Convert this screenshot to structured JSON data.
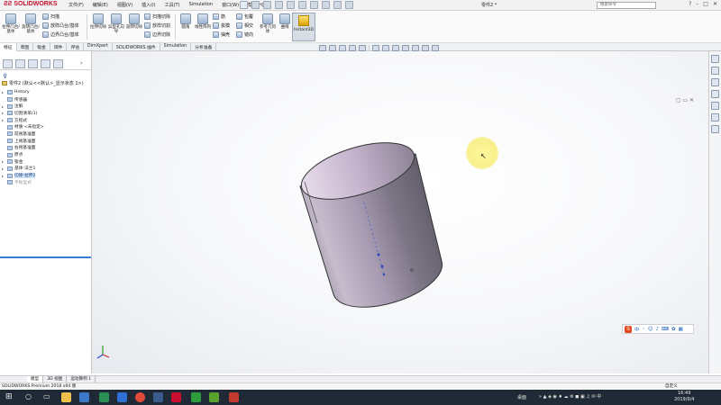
{
  "app": {
    "brand": "SOLIDWORKS",
    "menu": [
      "文件(F)",
      "编辑(E)",
      "视图(V)",
      "插入(I)",
      "工具(T)",
      "Simulation",
      "窗口(W)",
      "帮助(H)"
    ],
    "document_title": "零件2 *",
    "search_placeholder": "搜索命令"
  },
  "ribbon": {
    "big_buttons": [
      "拉伸凸台/基体",
      "旋转凸台/基体",
      "拉伸切除",
      "异型孔向导",
      "旋转切除",
      "圆角",
      "线性阵列",
      "参考几何体",
      "曲线"
    ],
    "small_buttons": [
      "扫描",
      "放样凸台/基体",
      "边界凸台/基体",
      "扫描切除",
      "放样切割",
      "边界切除",
      "筋",
      "拔模",
      "抽壳",
      "包覆",
      "相交",
      "镜向"
    ],
    "instant3d": "Instant3D"
  },
  "command_tabs": [
    "特征",
    "草图",
    "钣金",
    "焊件",
    "评估",
    "DimXpert",
    "SOLIDWORKS 插件",
    "Simulation",
    "分析准备"
  ],
  "tree": {
    "root": "零件2 (默认<<默认>_显示状态 1>)",
    "items": [
      {
        "label": "History",
        "exp": "▸",
        "state": "normal"
      },
      {
        "label": "传感器",
        "exp": "",
        "state": "normal"
      },
      {
        "label": "注解",
        "exp": "▸",
        "state": "normal"
      },
      {
        "label": "切割清单(1)",
        "exp": "▸",
        "state": "normal"
      },
      {
        "label": "方程式",
        "exp": "▸",
        "state": "normal"
      },
      {
        "label": "材质 <未指定>",
        "exp": "",
        "state": "normal"
      },
      {
        "label": "前视基准面",
        "exp": "",
        "state": "normal"
      },
      {
        "label": "上视基准面",
        "exp": "",
        "state": "normal"
      },
      {
        "label": "右视基准面",
        "exp": "",
        "state": "normal"
      },
      {
        "label": "原点",
        "exp": "",
        "state": "normal"
      },
      {
        "label": "钣金",
        "exp": "▸",
        "state": "normal"
      },
      {
        "label": "基体-法兰1",
        "exp": "▸",
        "state": "normal"
      },
      {
        "label": "切除-拉伸2",
        "exp": "▸",
        "state": "selected"
      },
      {
        "label": "平板型式",
        "exp": "",
        "state": "suppressed"
      }
    ]
  },
  "model_tabs": [
    "模型",
    "3D 视图",
    "运动算例 1"
  ],
  "status": {
    "left": "SOLIDWORKS Premium 2018 x64 版",
    "unit": "自定义"
  },
  "taskbar": {
    "desktop_label": "桌面",
    "time": "16:49",
    "date": "2019/9/4",
    "ime": "中"
  },
  "colors": {
    "accent": "#3a7bd5",
    "brand_red": "#c8102e",
    "taskbar": "#1f2a36"
  }
}
